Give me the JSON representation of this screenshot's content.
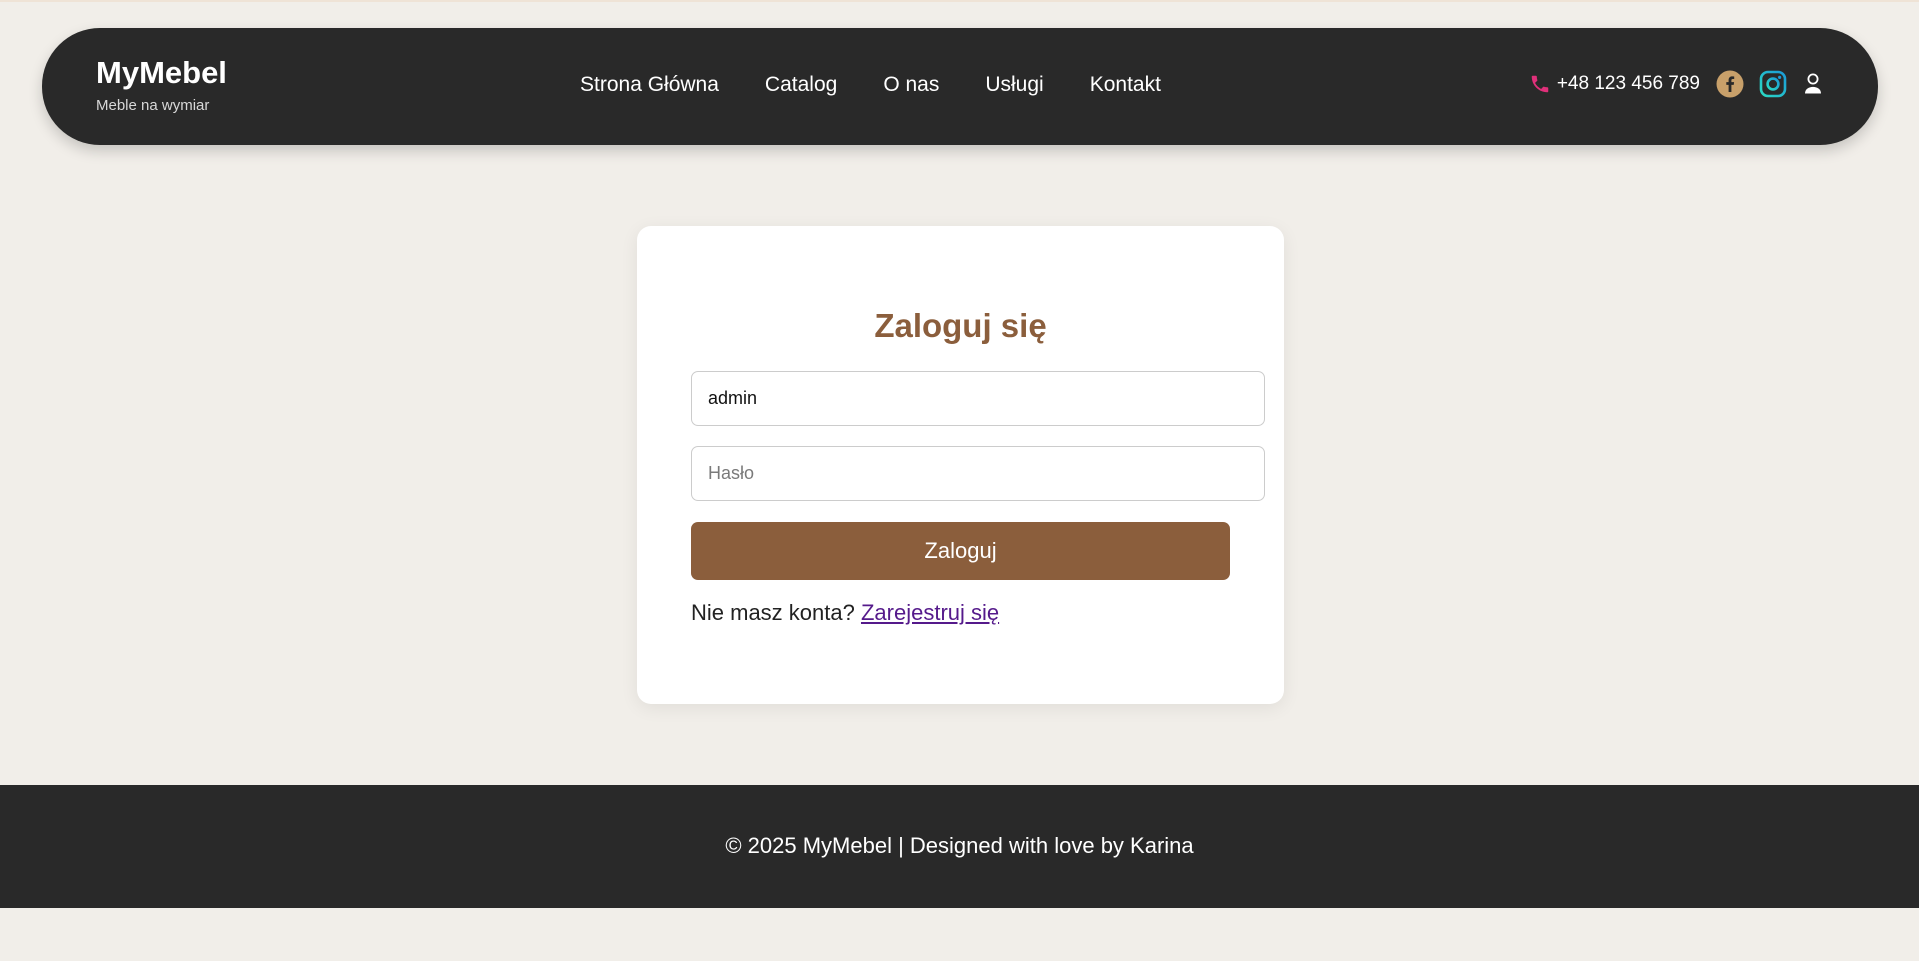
{
  "colors": {
    "page_background": "#f1eee9",
    "header_background": "#292929",
    "accent_brown": "#8b5e3c",
    "link_visited": "#551a8b",
    "phone_pink": "#e0307a",
    "facebook_gold": "#c8a06a",
    "instagram_gradient": [
      "#2bd9c3",
      "#1b9bd7"
    ]
  },
  "header": {
    "brand_name": "MyMebel",
    "tagline": "Meble na wymiar",
    "nav": [
      {
        "label": "Strona Główna"
      },
      {
        "label": "Catalog"
      },
      {
        "label": "O nas"
      },
      {
        "label": "Usługi"
      },
      {
        "label": "Kontakt"
      }
    ],
    "phone": "+48 123 456 789",
    "icons": [
      "phone-icon",
      "facebook-icon",
      "instagram-icon",
      "user-icon"
    ]
  },
  "login": {
    "title": "Zaloguj się",
    "username_value": "admin",
    "password_placeholder": "Hasło",
    "submit_label": "Zaloguj",
    "register_prompt": "Nie masz konta?",
    "register_link": "Zarejestruj się"
  },
  "footer": {
    "text": "© 2025 MyMebel | Designed with love by Karina"
  }
}
